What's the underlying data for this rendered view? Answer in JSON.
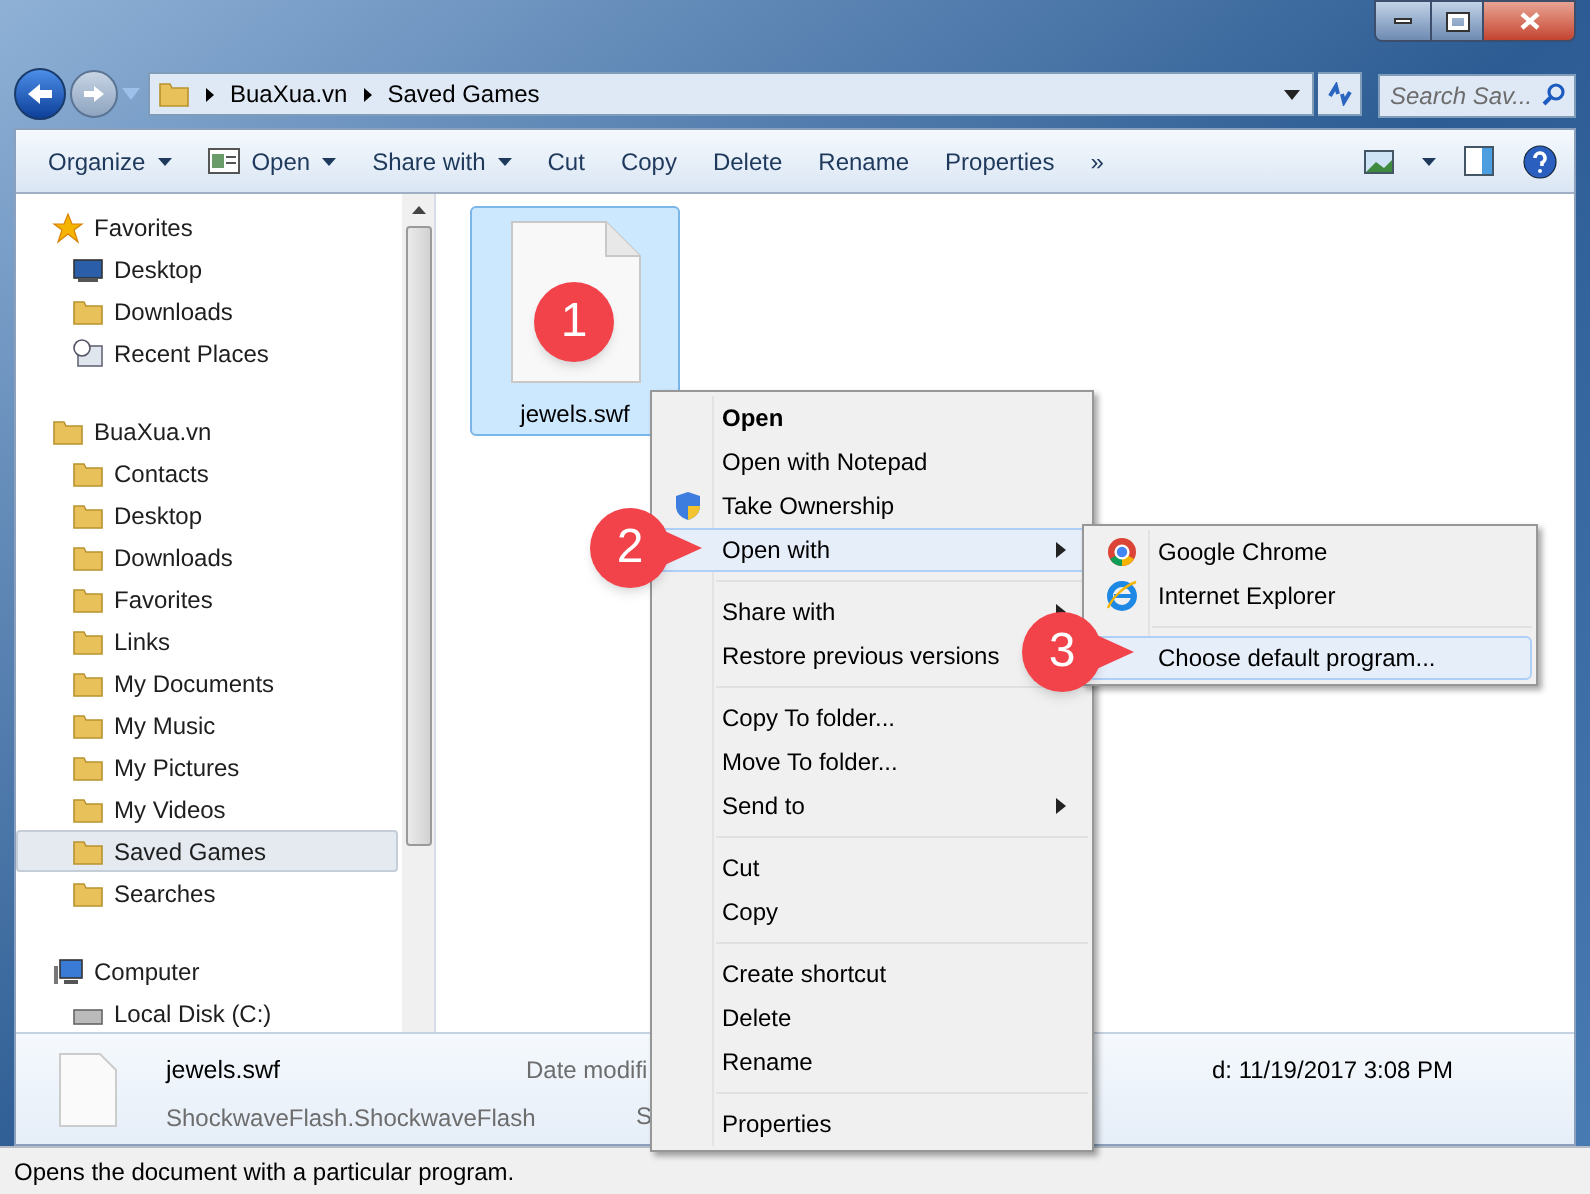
{
  "address_bar": {
    "path": [
      "BuaXua.vn",
      "Saved Games"
    ]
  },
  "search": {
    "placeholder": "Search Sav..."
  },
  "toolbar": [
    {
      "label": "Organize",
      "dropdown": true,
      "kind": "menu"
    },
    {
      "label": "Open",
      "dropdown": true,
      "kind": "open"
    },
    {
      "label": "Share with",
      "dropdown": true,
      "kind": "menu"
    },
    {
      "label": "Cut",
      "dropdown": false,
      "kind": "menu"
    },
    {
      "label": "Copy",
      "dropdown": false,
      "kind": "menu"
    },
    {
      "label": "Delete",
      "dropdown": false,
      "kind": "menu"
    },
    {
      "label": "Rename",
      "dropdown": false,
      "kind": "menu"
    },
    {
      "label": "Properties",
      "dropdown": false,
      "kind": "menu"
    },
    {
      "label": "»",
      "dropdown": false,
      "kind": "menu"
    }
  ],
  "nav": [
    {
      "label": "Favorites",
      "kind": "star",
      "selected": false,
      "children": [
        {
          "label": "Desktop",
          "kind": "desktop",
          "selected": false
        },
        {
          "label": "Downloads",
          "kind": "folder",
          "selected": false
        },
        {
          "label": "Recent Places",
          "kind": "recent",
          "selected": false
        }
      ]
    },
    {
      "label": "BuaXua.vn",
      "kind": "folder",
      "selected": false,
      "children": [
        {
          "label": "Contacts",
          "kind": "folder",
          "selected": false
        },
        {
          "label": "Desktop",
          "kind": "folder",
          "selected": false
        },
        {
          "label": "Downloads",
          "kind": "folder",
          "selected": false
        },
        {
          "label": "Favorites",
          "kind": "folder",
          "selected": false
        },
        {
          "label": "Links",
          "kind": "folder",
          "selected": false
        },
        {
          "label": "My Documents",
          "kind": "folder",
          "selected": false
        },
        {
          "label": "My Music",
          "kind": "folder",
          "selected": false
        },
        {
          "label": "My Pictures",
          "kind": "folder",
          "selected": false
        },
        {
          "label": "My Videos",
          "kind": "folder",
          "selected": false
        },
        {
          "label": "Saved Games",
          "kind": "folder",
          "selected": true
        },
        {
          "label": "Searches",
          "kind": "folder",
          "selected": false
        }
      ]
    },
    {
      "label": "Computer",
      "kind": "computer",
      "selected": false,
      "children": [
        {
          "label": "Local Disk (C:)",
          "kind": "disk",
          "selected": false
        }
      ]
    }
  ],
  "files": [
    {
      "name": "jewels.swf",
      "selected": true
    }
  ],
  "callouts": [
    "1",
    "2",
    "3"
  ],
  "context_menu": [
    {
      "label": "Open",
      "kind": "command",
      "default": true,
      "selected": false
    },
    {
      "label": "Open with Notepad",
      "kind": "command",
      "default": false,
      "selected": false
    },
    {
      "label": "Take Ownership",
      "kind": "shield",
      "default": false,
      "selected": false
    },
    {
      "label": "Open with",
      "kind": "submenu",
      "default": false,
      "selected": true
    },
    {
      "kind": "separator"
    },
    {
      "label": "Share with",
      "kind": "submenu",
      "default": false,
      "selected": false
    },
    {
      "label": "Restore previous versions",
      "kind": "command",
      "default": false,
      "selected": false
    },
    {
      "kind": "separator"
    },
    {
      "label": "Copy To folder...",
      "kind": "command",
      "default": false,
      "selected": false
    },
    {
      "label": "Move To folder...",
      "kind": "command",
      "default": false,
      "selected": false
    },
    {
      "label": "Send to",
      "kind": "submenu",
      "default": false,
      "selected": false
    },
    {
      "kind": "separator"
    },
    {
      "label": "Cut",
      "kind": "command",
      "default": false,
      "selected": false
    },
    {
      "label": "Copy",
      "kind": "command",
      "default": false,
      "selected": false
    },
    {
      "kind": "separator"
    },
    {
      "label": "Create shortcut",
      "kind": "command",
      "default": false,
      "selected": false
    },
    {
      "label": "Delete",
      "kind": "command",
      "default": false,
      "selected": false
    },
    {
      "label": "Rename",
      "kind": "command",
      "default": false,
      "selected": false
    },
    {
      "kind": "separator"
    },
    {
      "label": "Properties",
      "kind": "command",
      "default": false,
      "selected": false
    }
  ],
  "submenu": [
    {
      "label": "Google Chrome",
      "kind": "chrome",
      "selected": false
    },
    {
      "label": "Internet Explorer",
      "kind": "ie",
      "selected": false
    },
    {
      "kind": "separator"
    },
    {
      "label": "Choose default program...",
      "kind": "command",
      "selected": true
    }
  ],
  "details": {
    "name": "jewels.swf",
    "type": "ShockwaveFlash.ShockwaveFlash",
    "label_1": "Date modifi",
    "label_2": "S",
    "value": "d: 11/19/2017 3:08 PM"
  },
  "status_bar": {
    "text": "Opens the document with a particular program."
  }
}
